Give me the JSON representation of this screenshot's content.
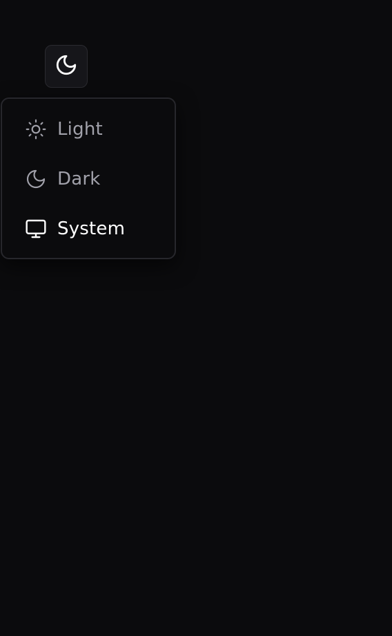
{
  "toggle": {
    "icon": "moon-icon"
  },
  "menu": {
    "items": [
      {
        "label": "Light",
        "icon": "sun-icon",
        "active": false
      },
      {
        "label": "Dark",
        "icon": "moon-icon",
        "active": false
      },
      {
        "label": "System",
        "icon": "monitor-icon",
        "active": true
      }
    ]
  },
  "colors": {
    "background": "#0b0b0d",
    "text_muted": "#a1a1aa",
    "text_active": "#ffffff",
    "border": "#27272c"
  }
}
